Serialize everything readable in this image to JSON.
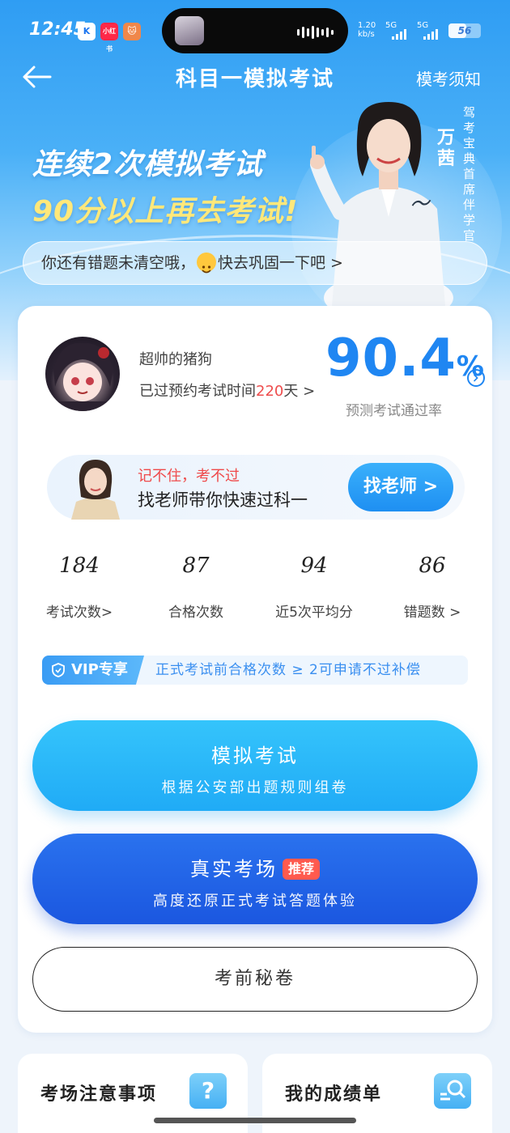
{
  "status_bar": {
    "time": "12:45",
    "net_speed_value": "1.20",
    "net_speed_unit": "kb/s",
    "signal1": "5G",
    "signal2": "5G",
    "battery": "56",
    "battery_level": 0.56
  },
  "nav": {
    "title": "科目一模拟考试",
    "right_link": "模考须知"
  },
  "banner": {
    "line1": "连续2次模拟考试",
    "line2": "90分以上再去考试!",
    "teacher_name": "万茜",
    "teacher_role": "驾考宝典首席伴学官",
    "signature": "万茜"
  },
  "notice": {
    "before": "你还有错题未清空哦，",
    "after": "快去巩固一下吧 >"
  },
  "profile": {
    "username": "超帅的猪狗",
    "passed_prefix": "已过预约考试时间",
    "passed_days": "220",
    "passed_suffix": "天 >",
    "rate_value": "90.4",
    "rate_unit": "%",
    "rate_label": "预测考试通过率"
  },
  "teacher_bar": {
    "line1": "记不住，考不过",
    "line2": "找老师带你快速过科一",
    "button": "找老师 >"
  },
  "stats": [
    {
      "value": "184",
      "label": "考试次数>"
    },
    {
      "value": "87",
      "label": "合格次数"
    },
    {
      "value": "94",
      "label": "近5次平均分"
    },
    {
      "value": "86",
      "label": "错题数 >"
    }
  ],
  "vip": {
    "tag": "VIP专享",
    "text": "正式考试前合格次数 ≥ 2可申请不过补偿"
  },
  "buttons": {
    "exam_title": "模拟考试",
    "exam_sub": "根据公安部出题规则组卷",
    "real_title": "真实考场",
    "real_badge": "推荐",
    "real_sub": "高度还原正式考试答题体验",
    "secret": "考前秘卷"
  },
  "bottom_cards": {
    "left_title": "考场注意事项",
    "left_icon": "?",
    "right_title": "我的成绩单"
  },
  "colors": {
    "accent": "#1f86f2",
    "warning": "#ef4a4a",
    "highlight": "#ffe87a"
  }
}
